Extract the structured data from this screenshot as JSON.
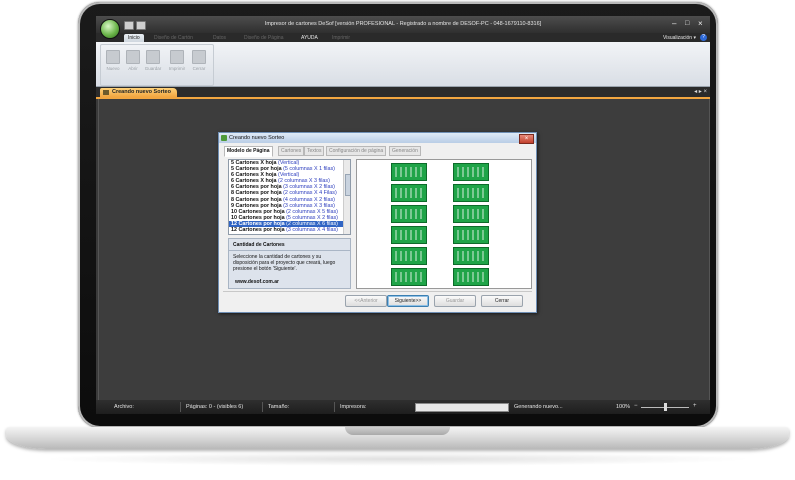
{
  "window": {
    "title": "Impresor de cartones DeSof [versión PROFESIONAL  - Registrado a nombre de DESOF-PC - 048-1679110-8316]"
  },
  "ribbon": {
    "tabs": [
      "Inicio",
      "Diseño de Cartón",
      "Datos",
      "Diseño de Página",
      "AYUDA",
      "Imprimir"
    ],
    "visualizacion": "Visualización",
    "buttons": [
      "Nuevo",
      "Abrir",
      "Guardar",
      "Imprimir",
      "Cerrar"
    ]
  },
  "document_tab": {
    "label": "Creando nuevo Sorteo"
  },
  "dialog": {
    "title": "Creando nuevo Sorteo",
    "tabs": [
      "Modelo de Página",
      "Cartones",
      "Textos",
      "Configuración de página",
      "Generación"
    ],
    "list_items": [
      {
        "main": "5 Cartones X hoja",
        "detail": "(Vertical)"
      },
      {
        "main": "5 Cartones por hoja",
        "detail": "(5 columnas X 1 filas)"
      },
      {
        "main": "6 Cartones X hoja",
        "detail": "(Vertical)"
      },
      {
        "main": "6 Cartones X hoja",
        "detail": "(2 columnas X 3 filas)"
      },
      {
        "main": "6 Cartones por hoja",
        "detail": "(3 columnas X 2 filas)"
      },
      {
        "main": "8 Cartones por hoja",
        "detail": "(2 columnas X 4 Filas)"
      },
      {
        "main": "8 Cartones por hoja",
        "detail": "(4 columnas X 2 filas)"
      },
      {
        "main": "9 Cartones por hoja",
        "detail": "(3 columnas X 3 filas)"
      },
      {
        "main": "10 Cartones por hoja",
        "detail": "(2 columnas X 5 filas)"
      },
      {
        "main": "10 Cartones por hoja",
        "detail": "(5 columnas X 2 filas)"
      },
      {
        "main": "12 Cartones por hoja",
        "detail": "(2 columnas X 6 filas)"
      },
      {
        "main": "12 Cartones por hoja",
        "detail": "(3 columnas X 4 filas)"
      }
    ],
    "selected_index": 10,
    "info": {
      "heading": "Cantidad de Cartones",
      "text": "Seleccione la cantidad de cartones y su disposición para el proyecto que creará, luego presione el botón 'Siguiente'.",
      "website": "www.desof.com.ar"
    },
    "preview": {
      "columns": 2,
      "rows": 6
    },
    "buttons": {
      "back": "<<Anterior",
      "next": "Siguiente>>",
      "save": "Guardar",
      "close": "Cerrar"
    }
  },
  "statusbar": {
    "archivo": "Archivo:",
    "paginas": "Páginas: 0 - (visibles 6)",
    "tamano": "Tamaño:",
    "impresora": "Impresora:",
    "generando": "Generando nuevo...",
    "zoom": "100%"
  }
}
